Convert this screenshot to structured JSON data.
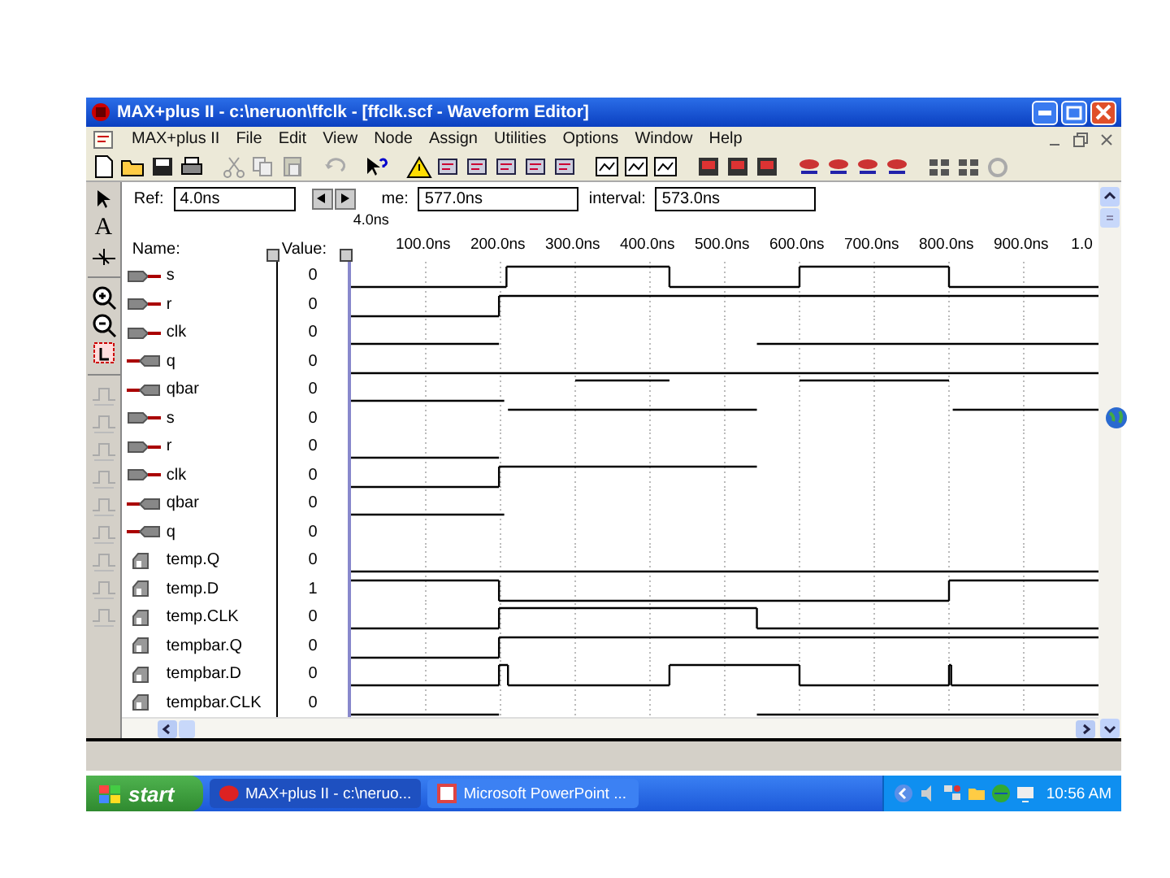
{
  "window": {
    "title": "MAX+plus II - c:\\neruon\\ffclk - [ffclk.scf - Waveform Editor]"
  },
  "menu": [
    "MAX+plus II",
    "File",
    "Edit",
    "View",
    "Node",
    "Assign",
    "Utilities",
    "Options",
    "Window",
    "Help"
  ],
  "side_tools": [
    {
      "kind": "pointer"
    },
    {
      "kind": "text",
      "label": "A"
    },
    {
      "kind": "node"
    },
    {
      "kind": "zoom-in"
    },
    {
      "kind": "zoom-out"
    },
    {
      "kind": "fit"
    },
    {
      "kind": "low"
    },
    {
      "kind": "high"
    },
    {
      "kind": "undefined"
    },
    {
      "kind": "high-z"
    },
    {
      "kind": "invert"
    },
    {
      "kind": "clock"
    },
    {
      "kind": "count"
    },
    {
      "kind": "group"
    },
    {
      "kind": "overwrite"
    }
  ],
  "fields": [
    {
      "label": "Ref:",
      "value": "4.0ns"
    },
    {
      "label": "me:",
      "value": "577.0ns"
    },
    {
      "label": "interval:",
      "value": "573.0ns"
    }
  ],
  "cursor_label": "4.0ns",
  "columns": {
    "name": "Name:",
    "value": "Value:"
  },
  "time_ticks": [
    "100.0ns",
    "200.0ns",
    "300.0ns",
    "400.0ns",
    "500.0ns",
    "600.0ns",
    "700.0ns",
    "800.0ns",
    "900.0ns",
    "1.0"
  ],
  "signals": [
    {
      "kind": "input",
      "name": "s",
      "value": "0"
    },
    {
      "kind": "input",
      "name": "r",
      "value": "0"
    },
    {
      "kind": "input",
      "name": "clk",
      "value": "0"
    },
    {
      "kind": "output",
      "name": "q",
      "value": "0"
    },
    {
      "kind": "output",
      "name": "qbar",
      "value": "0"
    },
    {
      "kind": "input",
      "name": "s",
      "value": "0"
    },
    {
      "kind": "input",
      "name": "r",
      "value": "0"
    },
    {
      "kind": "input",
      "name": "clk",
      "value": "0"
    },
    {
      "kind": "output",
      "name": "qbar",
      "value": "0"
    },
    {
      "kind": "output",
      "name": "q",
      "value": "0"
    },
    {
      "kind": "buried",
      "name": "temp.Q",
      "value": "0"
    },
    {
      "kind": "buried",
      "name": "temp.D",
      "value": "1"
    },
    {
      "kind": "buried",
      "name": "temp.CLK",
      "value": "0"
    },
    {
      "kind": "buried",
      "name": "tempbar.Q",
      "value": "0"
    },
    {
      "kind": "buried",
      "name": "tempbar.D",
      "value": "0"
    },
    {
      "kind": "buried",
      "name": "tempbar.CLK",
      "value": "0"
    }
  ],
  "taskbar": {
    "start": "start",
    "tasks": [
      {
        "label": "MAX+plus II - c:\\neruo...",
        "selected": true
      },
      {
        "label": "Microsoft PowerPoint ...",
        "selected": false
      }
    ],
    "clock": "10:56 AM"
  }
}
